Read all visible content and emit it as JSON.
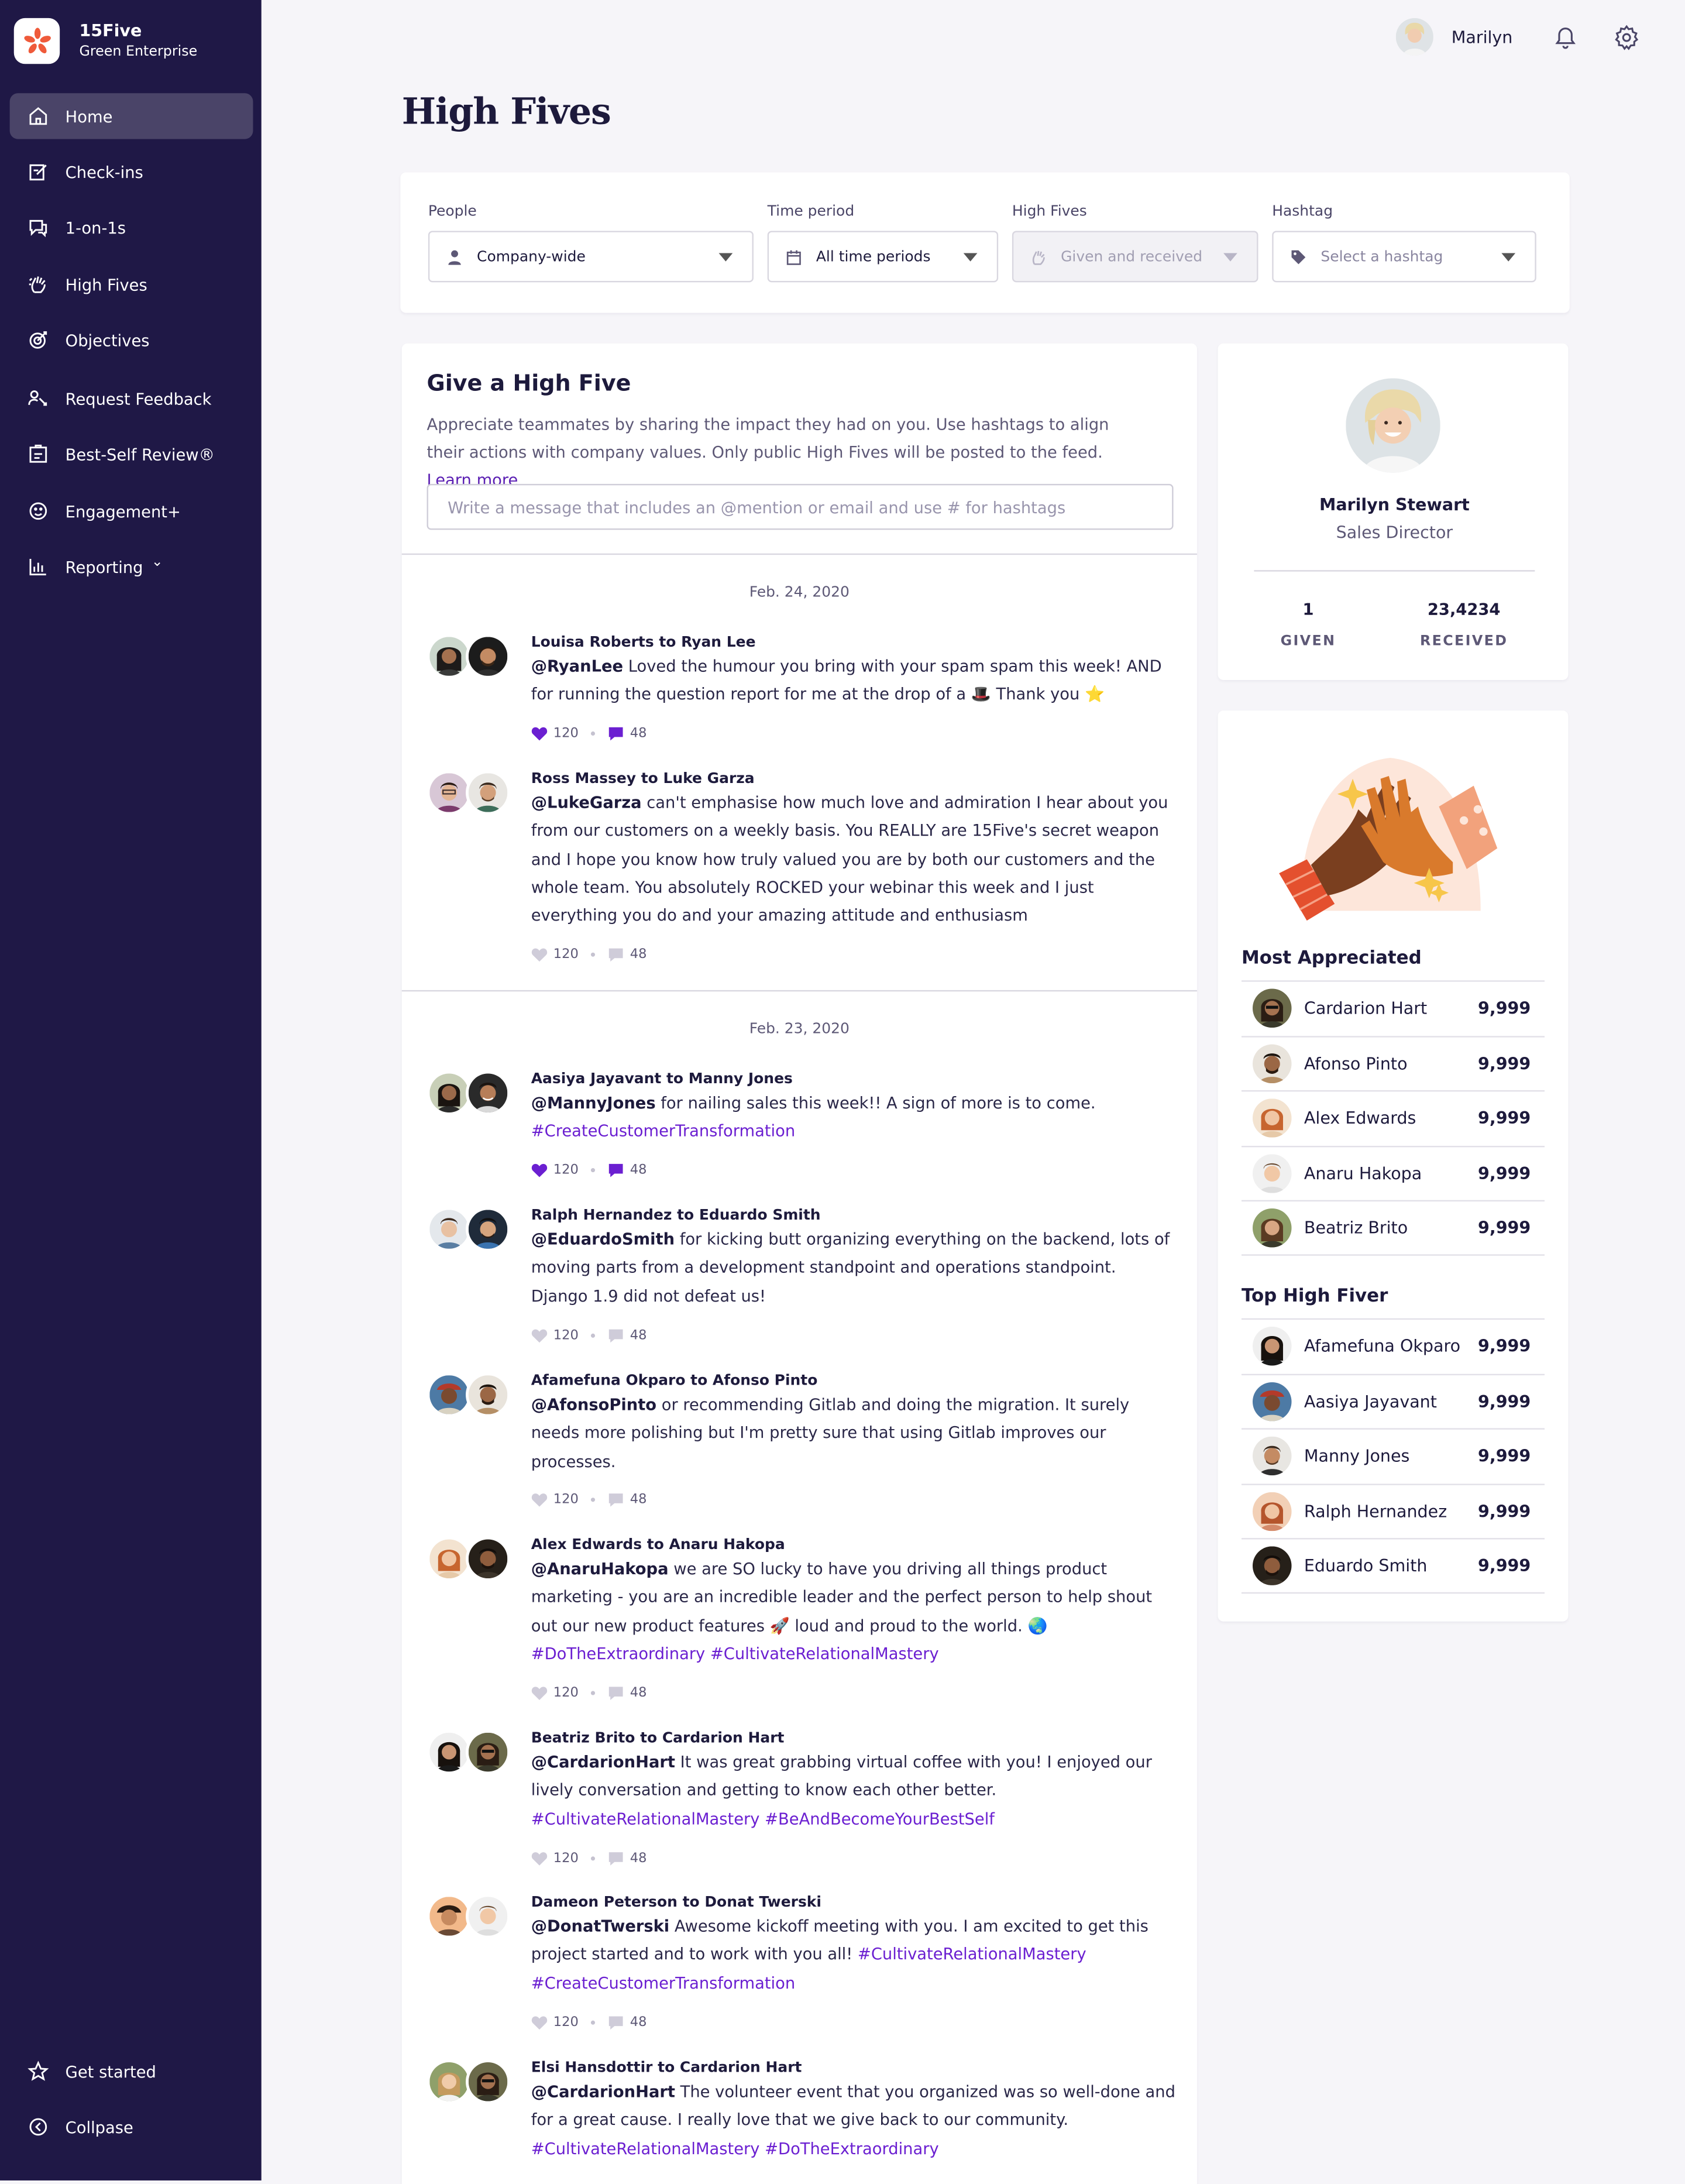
{
  "brand": {
    "name": "15Five",
    "org": "Green Enterprise",
    "logo": "15five-flower-logo"
  },
  "nav": {
    "items": [
      {
        "label": "Home",
        "icon": "home-icon"
      },
      {
        "label": "Check-ins",
        "icon": "checkin-icon"
      },
      {
        "label": "1-on-1s",
        "icon": "chat-icon"
      },
      {
        "label": "High Fives",
        "icon": "hand-icon"
      },
      {
        "label": "Objectives",
        "icon": "target-icon"
      },
      {
        "label": "Request Feedback",
        "icon": "feedback-icon"
      },
      {
        "label": "Best-Self Review®",
        "icon": "review-icon"
      },
      {
        "label": "Engagement+",
        "icon": "engagement-icon"
      },
      {
        "label": "Reporting",
        "icon": "reporting-icon"
      }
    ],
    "reporting_chevron": "⌄",
    "bottom": [
      {
        "label": "Get started",
        "icon": "star-icon"
      },
      {
        "label": "Collpase",
        "icon": "collapse-icon"
      }
    ]
  },
  "topbar": {
    "user_name": "Marilyn",
    "icons": [
      "bell-icon",
      "gear-icon"
    ]
  },
  "page": {
    "title": "High Fives"
  },
  "filters": {
    "people": {
      "label": "People",
      "value": "Company-wide"
    },
    "time": {
      "label": "Time period",
      "value": "All time periods"
    },
    "highfives": {
      "label": "High Fives",
      "value": "Given and received"
    },
    "hashtag": {
      "label": "Hashtag",
      "placeholder": "Select a hashtag"
    }
  },
  "give": {
    "title": "Give a High Five",
    "description": "Appreciate teammates by sharing the impact they had on you. Use hashtags to align their actions with company values. Only public High Fives will be posted to the feed.",
    "learn_more": "Learn more",
    "input_placeholder": "Write a message that includes an @mention or email and use # for hashtags"
  },
  "feed": {
    "dates": [
      "Feb. 24, 2020",
      "Feb. 23, 2020"
    ],
    "posts": [
      {
        "title": "Louisa Roberts to Ryan Lee",
        "mention": "@RyanLee",
        "text": "Loved the humour you bring with your spam spam this week! AND for running the question report for me at the drop of a 🎩 Thank you ⭐",
        "likes": "120",
        "comments": "48",
        "active": true
      },
      {
        "title": "Ross Massey to Luke Garza",
        "mention": "@LukeGarza",
        "text": "can't emphasise how much love and admiration I hear about you from our customers on a weekly basis. You REALLY are 15Five's secret weapon and I hope you know how truly valued you are by both our customers and the whole team. You absolutely ROCKED your webinar this week and I just everything you do and your amazing attitude and enthusiasm",
        "likes": "120",
        "comments": "48",
        "active": false
      },
      {
        "title": "Aasiya Jayavant to Manny Jones",
        "mention": "@MannyJones",
        "text": "for nailing sales this week!!  A sign of more is to come.",
        "tags": "#CreateCustomerTransformation",
        "likes": "120",
        "comments": "48",
        "active": true
      },
      {
        "title": "Ralph Hernandez to Eduardo Smith",
        "mention": "@EduardoSmith",
        "text": "for kicking butt organizing everything on the backend, lots of moving parts from a development standpoint and operations standpoint.  Django 1.9 did not defeat us!",
        "likes": "120",
        "comments": "48",
        "active": false
      },
      {
        "title": "Afamefuna Okparo to Afonso Pinto",
        "mention": "@AfonsoPinto",
        "text": "or recommending Gitlab and doing the migration. It surely needs more polishing but I'm pretty sure that using Gitlab improves our processes.",
        "likes": "120",
        "comments": "48",
        "active": false
      },
      {
        "title": "Alex Edwards to Anaru Hakopa",
        "mention": "@AnaruHakopa",
        "text": "we are SO lucky to have you driving all things product marketing - you are an incredible leader and the perfect person to help shout out our new product features 🚀 loud and proud to the world. 🌏",
        "tags": "#DoTheExtraordinary #CultivateRelationalMastery",
        "likes": "120",
        "comments": "48",
        "active": false
      },
      {
        "title": "Beatriz Brito to Cardarion Hart",
        "mention": "@CardarionHart",
        "text": "It was great grabbing virtual coffee with you! I enjoyed our lively conversation and getting to know each other better.",
        "tags": "#CultivateRelationalMastery #BeAndBecomeYourBestSelf",
        "likes": "120",
        "comments": "48",
        "active": false
      },
      {
        "title": "Dameon Peterson to Donat Twerski",
        "mention": "@DonatTwerski",
        "text": "Awesome kickoff meeting with you. I am excited to get this project started and to work with you all!",
        "tags": "#CultivateRelationalMastery #CreateCustomerTransformation",
        "likes": "120",
        "comments": "48",
        "active": false
      },
      {
        "title": "Elsi Hansdottir to Cardarion Hart",
        "mention": "@CardarionHart",
        "text": "The volunteer event that you organized was so well-done and for a great cause. I really love that we give back to our community.",
        "tags": "#CultivateRelationalMastery #DoTheExtraordinary",
        "likes": "",
        "comments": "",
        "active": false
      }
    ]
  },
  "profile": {
    "name": "Marilyn Stewart",
    "role": "Sales Director",
    "given": "1",
    "given_label": "GIVEN",
    "received": "23,4234",
    "received_label": "RECEIVED"
  },
  "illustration": "high-five-hands-illustration",
  "most_appreciated": {
    "title": "Most Appreciated",
    "rows": [
      {
        "name": "Cardarion Hart",
        "score": "9,999"
      },
      {
        "name": "Afonso Pinto",
        "score": "9,999"
      },
      {
        "name": "Alex Edwards",
        "score": "9,999"
      },
      {
        "name": "Anaru Hakopa",
        "score": "9,999"
      },
      {
        "name": "Beatriz Brito",
        "score": "9,999"
      }
    ]
  },
  "top_high_fiver": {
    "title": "Top High Fiver",
    "rows": [
      {
        "name": "Afamefuna Okparo",
        "score": "9,999"
      },
      {
        "name": "Aasiya Jayavant",
        "score": "9,999"
      },
      {
        "name": "Manny Jones",
        "score": "9,999"
      },
      {
        "name": "Ralph Hernandez",
        "score": "9,999"
      },
      {
        "name": "Eduardo Smith",
        "score": "9,999"
      }
    ]
  },
  "colors": {
    "sidebar": "#1f1846",
    "accent": "#6b1fd1",
    "heart": "#6b1fd1",
    "muted_icon": "#c8c5d4"
  }
}
